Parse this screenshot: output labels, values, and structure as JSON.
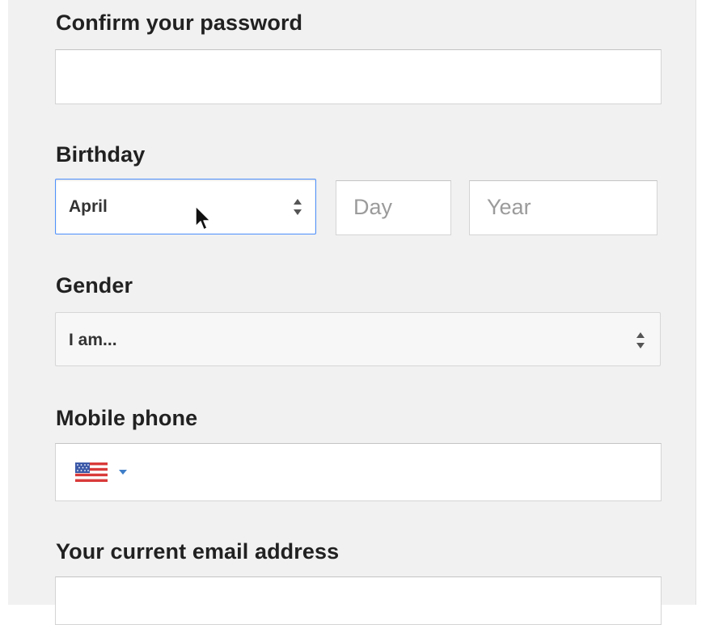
{
  "confirm_password": {
    "label": "Confirm your password",
    "value": ""
  },
  "birthday": {
    "label": "Birthday",
    "month": {
      "selected": "April",
      "icon": "sort-arrows-icon"
    },
    "day": {
      "placeholder": "Day"
    },
    "year": {
      "placeholder": "Year"
    }
  },
  "gender": {
    "label": "Gender",
    "selected": "I am...",
    "icon": "sort-arrows-icon"
  },
  "mobile_phone": {
    "label": "Mobile phone",
    "country_flag": "us-flag-icon",
    "dropdown_icon": "caret-down-icon",
    "value": ""
  },
  "current_email": {
    "label": "Your current email address",
    "value": ""
  },
  "colors": {
    "page_background": "#f1f1f1",
    "focus_border": "#4d90fe",
    "caret": "#3f7ec8"
  }
}
